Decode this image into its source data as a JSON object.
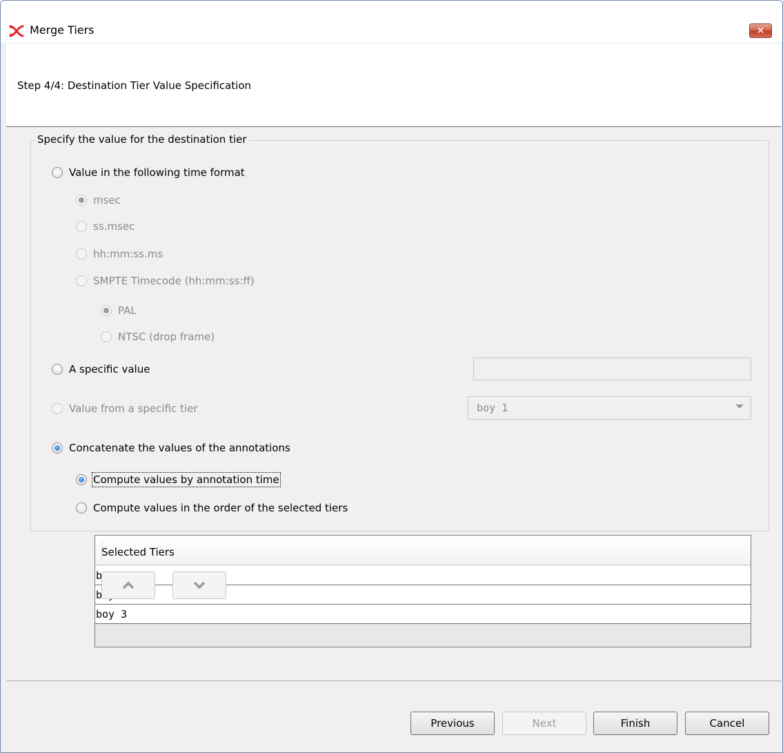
{
  "window": {
    "title": "Merge Tiers",
    "close_label": "✕"
  },
  "header": {
    "step_label": "Step 4/4: Destination Tier Value Specification"
  },
  "group": {
    "legend": "Specify the value for the destination tier"
  },
  "options": {
    "time_format": {
      "label": "Value in the following time format",
      "checked": false,
      "sub": [
        {
          "label": "msec",
          "checked": true,
          "enabled": false
        },
        {
          "label": "ss.msec",
          "checked": false,
          "enabled": false
        },
        {
          "label": "hh:mm:ss.ms",
          "checked": false,
          "enabled": false
        },
        {
          "label": "SMPTE Timecode (hh:mm:ss:ff)",
          "checked": false,
          "enabled": false
        }
      ],
      "smpte_sub": [
        {
          "label": "PAL",
          "checked": true,
          "enabled": false
        },
        {
          "label": "NTSC (drop frame)",
          "checked": false,
          "enabled": false
        }
      ]
    },
    "specific_value": {
      "label": "A specific value",
      "checked": false,
      "input_value": ""
    },
    "from_tier": {
      "label": "Value from a specific tier",
      "checked": false,
      "enabled": false,
      "selected_tier": "boy 1"
    },
    "concatenate": {
      "label": "Concatenate the values of the annotations",
      "checked": true,
      "sub": [
        {
          "label": "Compute values by annotation time",
          "checked": true
        },
        {
          "label": "Compute values in the order of the selected tiers",
          "checked": false
        }
      ]
    }
  },
  "tiers_table": {
    "header": "Selected Tiers",
    "rows": [
      "boy 1",
      "boy 2",
      "boy 3"
    ]
  },
  "order_buttons": {
    "up_icon": "chevron-up-icon",
    "down_icon": "chevron-down-icon"
  },
  "footer": {
    "previous": "Previous",
    "next": "Next",
    "finish": "Finish",
    "cancel": "Cancel"
  },
  "colors": {
    "selected_radio": "#1466b8",
    "close_button": "#c13b22",
    "app_icon": "#e0262b"
  }
}
